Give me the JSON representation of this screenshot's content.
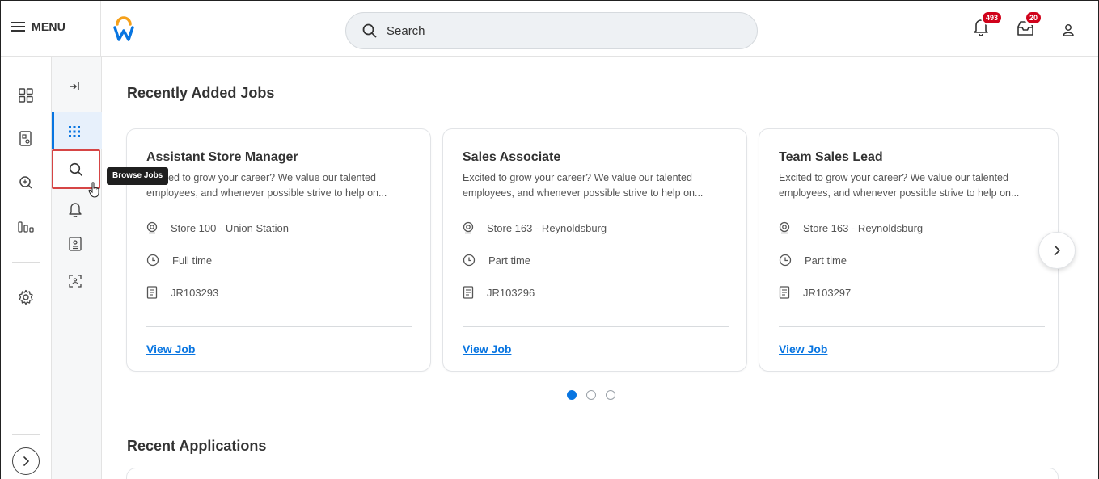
{
  "topbar": {
    "menu_label": "MENU",
    "search_placeholder": "Search",
    "notifications_count": "493",
    "inbox_count": "20"
  },
  "rail": {
    "tooltip": "Browse Jobs"
  },
  "main": {
    "recent_jobs_title": "Recently Added Jobs",
    "recent_apps_title": "Recent Applications",
    "jobs": [
      {
        "title": "Assistant Store Manager",
        "desc_line1": "Excited to grow your career? We value our talented",
        "desc_line2": "employees, and whenever possible strive to help on...",
        "location": "Store 100 - Union Station",
        "time_type": "Full time",
        "req_id": "JR103293",
        "link": "View Job"
      },
      {
        "title": "Sales Associate",
        "desc_line1": "Excited to grow your career? We value our talented",
        "desc_line2": "employees, and whenever possible strive to help on...",
        "location": "Store 163 - Reynoldsburg",
        "time_type": "Part time",
        "req_id": "JR103296",
        "link": "View Job"
      },
      {
        "title": "Team Sales Lead",
        "desc_line1": "Excited to grow your career? We value our talented",
        "desc_line2": "employees, and whenever possible strive to help on...",
        "location": "Store 163 - Reynoldsburg",
        "time_type": "Part time",
        "req_id": "JR103297",
        "link": "View Job"
      }
    ],
    "carousel": {
      "page_count": 3,
      "active_page": 1
    }
  },
  "colors": {
    "accent": "#0875e1",
    "badge": "#d0021b",
    "highlight": "#d64545"
  }
}
